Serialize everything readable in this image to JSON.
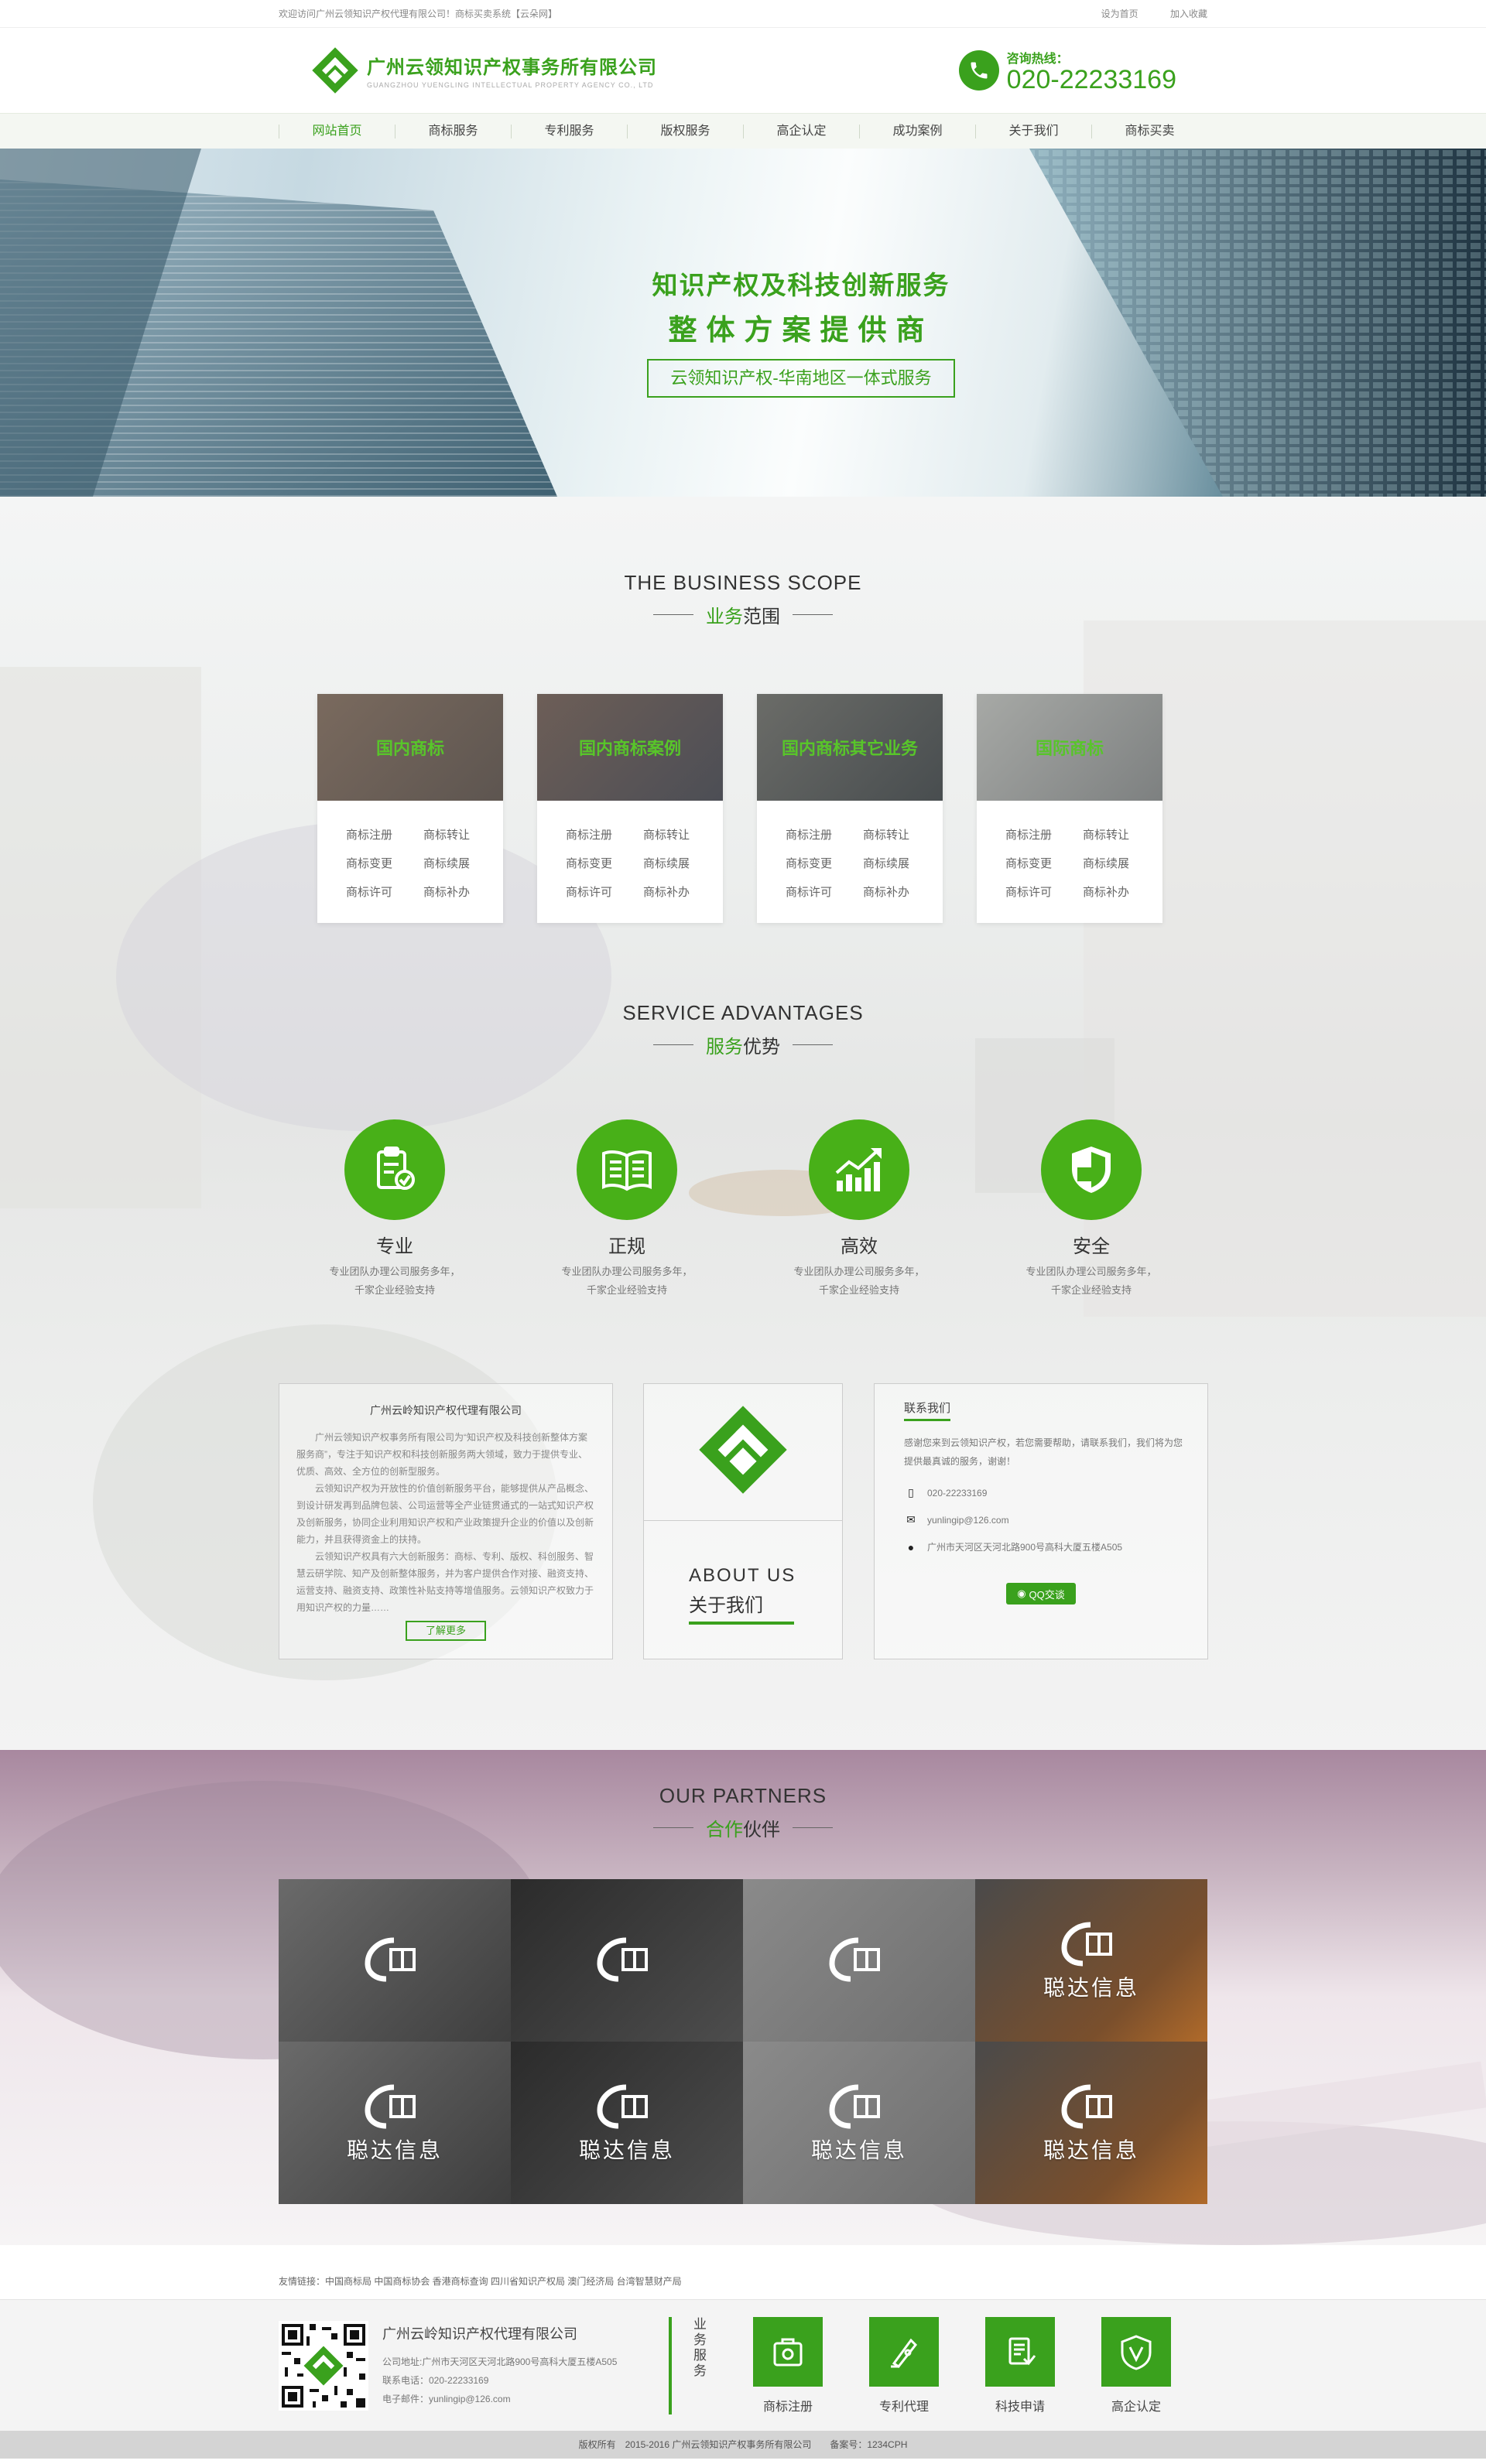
{
  "topbar": {
    "welcome": "欢迎访问广州云领知识产权代理有限公司！商标买卖系统【云朵网】",
    "set_home": "设为首页",
    "favorite": "加入收藏"
  },
  "brand": {
    "name": "广州云领知识产权事务所有限公司",
    "name_en": "GUANGZHOU YUENGLING INTELLECTUAL PROPERTY AGENCY CO., LTD",
    "color": "#3aa11d"
  },
  "hotline": {
    "label": "咨询热线：",
    "number": "020-22233169"
  },
  "nav": [
    "网站首页",
    "商标服务",
    "专利服务",
    "版权服务",
    "高企认定",
    "成功案例",
    "关于我们",
    "商标买卖"
  ],
  "banner": {
    "line1": "知识产权及科技创新服务",
    "line2": "整体方案提供商",
    "tag": "云领知识产权-华南地区一体式服务"
  },
  "scope": {
    "title_en": "THE BUSINESS SCOPE",
    "title_green": "业务",
    "title_rest": "范围",
    "cards": [
      {
        "title": "国内商标",
        "items": [
          "商标注册",
          "商标转让",
          "商标变更",
          "商标续展",
          "商标许可",
          "商标补办"
        ]
      },
      {
        "title": "国内商标案例",
        "items": [
          "商标注册",
          "商标转让",
          "商标变更",
          "商标续展",
          "商标许可",
          "商标补办"
        ]
      },
      {
        "title": "国内商标其它业务",
        "items": [
          "商标注册",
          "商标转让",
          "商标变更",
          "商标续展",
          "商标许可",
          "商标补办"
        ]
      },
      {
        "title": "国际商标",
        "items": [
          "商标注册",
          "商标转让",
          "商标变更",
          "商标续展",
          "商标许可",
          "商标补办"
        ]
      }
    ]
  },
  "advantages": {
    "title_en": "SERVICE ADVANTAGES",
    "title_green": "服务",
    "title_rest": "优势",
    "items": [
      {
        "title": "专业",
        "icon": "clipboard-check-icon",
        "desc1": "专业团队办理公司服务多年，",
        "desc2": "千家企业经验支持"
      },
      {
        "title": "正规",
        "icon": "book-icon",
        "desc1": "专业团队办理公司服务多年，",
        "desc2": "千家企业经验支持"
      },
      {
        "title": "高效",
        "icon": "growth-chart-icon",
        "desc1": "专业团队办理公司服务多年，",
        "desc2": "千家企业经验支持"
      },
      {
        "title": "安全",
        "icon": "shield-icon",
        "desc1": "专业团队办理公司服务多年，",
        "desc2": "千家企业经验支持"
      }
    ]
  },
  "about": {
    "company": "广州云岭知识产权代理有限公司",
    "p1": "广州云领知识产权事务所有限公司为“知识产权及科技创新整体方案服务商”，专注于知识产权和科技创新服务两大领域，致力于提供专业、优质、高效、全方位的创新型服务。",
    "p2": "云领知识产权为开放性的价值创新服务平台，能够提供从产品概念、到设计研发再到品牌包装、公司运营等全产业链贯通式的一站式知识产权及创新服务，协同企业利用知识产权和产业政策提升企业的价值以及创新能力，并且获得资金上的扶持。",
    "p3": "云领知识产权具有六大创新服务：商标、专利、版权、科创服务、智慧云研学院、知产及创新整体服务，并为客户提供合作对接、融资支持、运营支持、融资支持、政策性补贴支持等增值服务。云领知识产权致力于用知识产权的力量……",
    "more": "了解更多",
    "about_en": "ABOUT US",
    "about_cn": "关于我们"
  },
  "contact": {
    "title": "联系我们",
    "desc": "感谢您来到云领知识产权，若您需要帮助，请联系我们，我们将为您提供最真诚的服务，谢谢！",
    "phone": "020-22233169",
    "email": "yunlingip@126.com",
    "address": "广州市天河区天河北路900号高科大厦五楼A505",
    "qq": "QQ交谈"
  },
  "partners": {
    "title_en": "OUR PARTNERS",
    "title_green": "合作",
    "title_rest": "伙伴",
    "tiles": [
      {
        "name": ""
      },
      {
        "name": ""
      },
      {
        "name": ""
      },
      {
        "name": "聪达信息"
      },
      {
        "name": "聪达信息"
      },
      {
        "name": "聪达信息"
      },
      {
        "name": "聪达信息"
      },
      {
        "name": "聪达信息"
      }
    ]
  },
  "friend_links": "友情链接：中国商标局 中国商标协会 香港商标查询 四川省知识产权局 澳门经济局 台湾智慧财产局",
  "footer": {
    "company": "广州云岭知识产权代理有限公司",
    "address": "公司地址:广州市天河区天河北路900号高科大厦五楼A505",
    "tel": "联系电话：020-22233169",
    "email": "电子邮件：yunlingip@126.com",
    "services_label": "业务服务",
    "services": [
      {
        "name": "商标注册",
        "icon": "trademark-icon"
      },
      {
        "name": "专利代理",
        "icon": "patent-pen-icon"
      },
      {
        "name": "科技申请",
        "icon": "tech-apply-icon"
      },
      {
        "name": "高企认定",
        "icon": "shield-v-icon"
      }
    ]
  },
  "copyright": "版权所有　2015-2016 广州云领知识产权事务所有限公司　　备案号：1234CPH"
}
